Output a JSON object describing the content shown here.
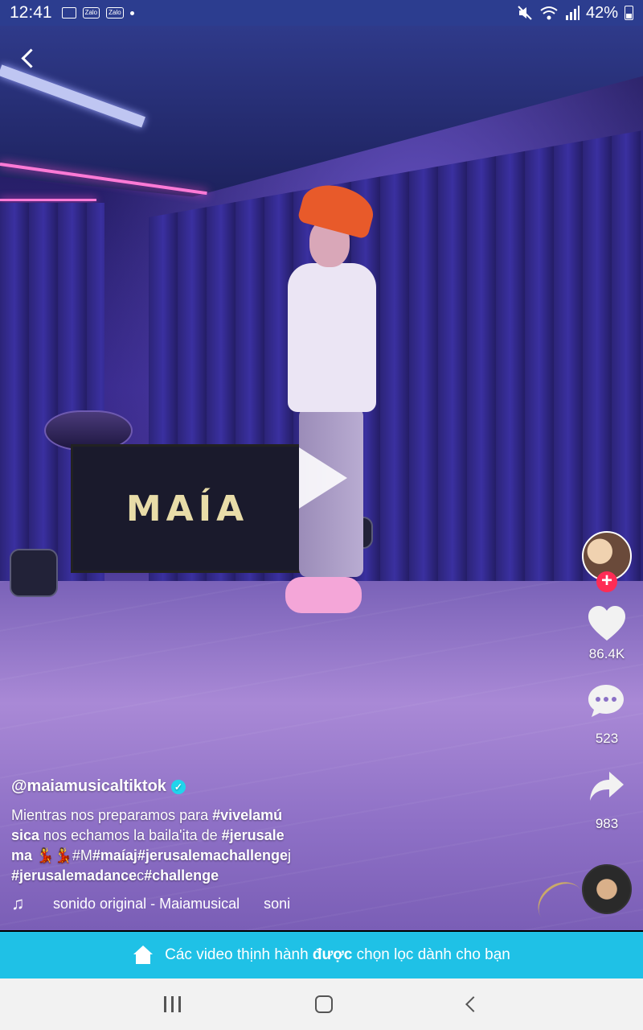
{
  "status_bar": {
    "time": "12:41",
    "apps": [
      "Zalo",
      "Zalo"
    ],
    "battery": "42%"
  },
  "video": {
    "sign_text": "MAÍA",
    "state": "paused"
  },
  "actions": {
    "likes": "86.4K",
    "comments": "523",
    "shares": "983"
  },
  "caption": {
    "username": "@maiamusicaltiktok",
    "verified": true,
    "text_plain_1": "Mientras nos preparamos para ",
    "hashtag_1": "#vivelamú",
    "hashtag_1b": "sica",
    "text_plain_2": " nos echamos la baila'ita de ",
    "hashtag_2": "#jerusale",
    "hashtag_2b": "ma",
    "emojis": "💃💃",
    "text_plain_3": "#M",
    "hashtag_3": "#maíaj",
    "hashtag_4": "#jerusalemachallenge",
    "text_plain_4": "j",
    "hashtag_5": "#jerusalemadance",
    "text_plain_5": "c",
    "hashtag_6": "#challenge"
  },
  "music": {
    "sound_label": "sonido original - Maiamusical",
    "sound_tail": "soni"
  },
  "banner": {
    "text_part1": "Các video thịnh hành ",
    "text_bold": "được",
    "text_part2": " chọn lọc dành cho bạn"
  },
  "icons": {
    "back": "chevron-left-icon",
    "like": "heart-icon",
    "comment": "comment-icon",
    "share": "share-icon",
    "music": "music-note-icon",
    "home": "home-icon"
  }
}
